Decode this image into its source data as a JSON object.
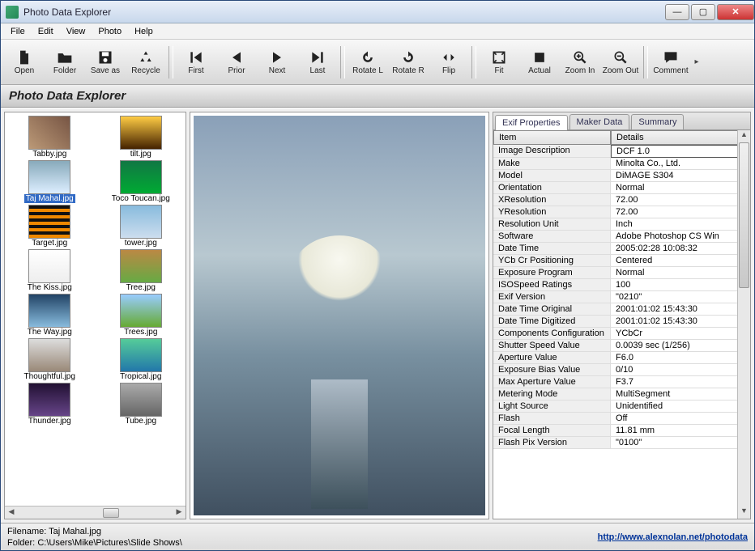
{
  "window": {
    "title": "Photo Data Explorer"
  },
  "menu": [
    "File",
    "Edit",
    "View",
    "Photo",
    "Help"
  ],
  "toolbar": [
    {
      "name": "open",
      "label": "Open",
      "icon": "file"
    },
    {
      "name": "folder",
      "label": "Folder",
      "icon": "folder"
    },
    {
      "name": "saveas",
      "label": "Save as",
      "icon": "save"
    },
    {
      "name": "recycle",
      "label": "Recycle",
      "icon": "recycle"
    },
    {
      "sep": true
    },
    {
      "name": "first",
      "label": "First",
      "icon": "first"
    },
    {
      "name": "prior",
      "label": "Prior",
      "icon": "prev"
    },
    {
      "name": "next",
      "label": "Next",
      "icon": "next"
    },
    {
      "name": "last",
      "label": "Last",
      "icon": "last"
    },
    {
      "sep": true
    },
    {
      "name": "rotl",
      "label": "Rotate L",
      "icon": "rotl"
    },
    {
      "name": "rotr",
      "label": "Rotate R",
      "icon": "rotr"
    },
    {
      "name": "flip",
      "label": "Flip",
      "icon": "flip"
    },
    {
      "sep": true
    },
    {
      "name": "fit",
      "label": "Fit",
      "icon": "fit"
    },
    {
      "name": "actual",
      "label": "Actual",
      "icon": "actual"
    },
    {
      "name": "zoomin",
      "label": "Zoom In",
      "icon": "zoomin"
    },
    {
      "name": "zoomout",
      "label": "Zoom Out",
      "icon": "zoomout"
    },
    {
      "sep": true
    },
    {
      "name": "comment",
      "label": "Comment",
      "icon": "comment"
    }
  ],
  "header": {
    "title": "Photo Data Explorer"
  },
  "thumbs": [
    {
      "label": "Tabby.jpg",
      "bg": "linear-gradient(45deg,#b97,#754)"
    },
    {
      "label": "tilt.jpg",
      "bg": "linear-gradient(#fc4,#420)"
    },
    {
      "label": "Taj Mahal.jpg",
      "bg": "linear-gradient(#8ab,#def)",
      "sel": true
    },
    {
      "label": "Toco Toucan.jpg",
      "bg": "linear-gradient(#174,#0a3)"
    },
    {
      "label": "Target.jpg",
      "bg": "repeating-linear-gradient(0deg,#e80,#e80 4px,#111 4px,#111 8px)"
    },
    {
      "label": "tower.jpg",
      "bg": "linear-gradient(#8bd,#cde)"
    },
    {
      "label": "The Kiss.jpg",
      "bg": "linear-gradient(#fff,#eee)"
    },
    {
      "label": "Tree.jpg",
      "bg": "linear-gradient(#b84,#6a4)"
    },
    {
      "label": "The Way.jpg",
      "bg": "linear-gradient(#246,#8bd)"
    },
    {
      "label": "Trees.jpg",
      "bg": "linear-gradient(#9cf,#6a3)"
    },
    {
      "label": "Thoughtful.jpg",
      "bg": "linear-gradient(#ddd,#987)"
    },
    {
      "label": "Tropical.jpg",
      "bg": "linear-gradient(#5c9,#27a)"
    },
    {
      "label": "Thunder.jpg",
      "bg": "linear-gradient(#213,#648)"
    },
    {
      "label": "Tube.jpg",
      "bg": "linear-gradient(#aaa,#666)"
    }
  ],
  "tabs": [
    "Exif Properties",
    "Maker Data",
    "Summary"
  ],
  "active_tab": 0,
  "grid": {
    "headers": [
      "Item",
      "Details"
    ],
    "rows": [
      [
        "Image Description",
        "DCF 1.0"
      ],
      [
        "Make",
        "Minolta Co., Ltd."
      ],
      [
        "Model",
        "DiMAGE S304"
      ],
      [
        "Orientation",
        "Normal"
      ],
      [
        "XResolution",
        "72.00"
      ],
      [
        "YResolution",
        "72.00"
      ],
      [
        "Resolution Unit",
        "Inch"
      ],
      [
        "Software",
        "Adobe Photoshop CS Win"
      ],
      [
        "Date Time",
        "2005:02:28 10:08:32"
      ],
      [
        "YCb Cr Positioning",
        "Centered"
      ],
      [
        "Exposure Program",
        "Normal"
      ],
      [
        "ISOSpeed Ratings",
        "100"
      ],
      [
        "Exif Version",
        "\"0210\""
      ],
      [
        "Date Time Original",
        "2001:01:02 15:43:30"
      ],
      [
        "Date Time Digitized",
        "2001:01:02 15:43:30"
      ],
      [
        "Components Configuration",
        "YCbCr"
      ],
      [
        "Shutter Speed Value",
        "0.0039 sec (1/256)"
      ],
      [
        "Aperture Value",
        "F6.0"
      ],
      [
        "Exposure Bias Value",
        "0/10"
      ],
      [
        "Max Aperture Value",
        "F3.7"
      ],
      [
        "Metering Mode",
        "MultiSegment"
      ],
      [
        "Light Source",
        "Unidentified"
      ],
      [
        "Flash",
        "Off"
      ],
      [
        "Focal Length",
        "11.81 mm"
      ],
      [
        "Flash Pix Version",
        "\"0100\""
      ]
    ]
  },
  "status": {
    "filename_label": "Filename:",
    "filename": "Taj Mahal.jpg",
    "folder_label": "Folder:",
    "folder": "C:\\Users\\Mike\\Pictures\\Slide Shows\\",
    "link": "http://www.alexnolan.net/photodata"
  }
}
